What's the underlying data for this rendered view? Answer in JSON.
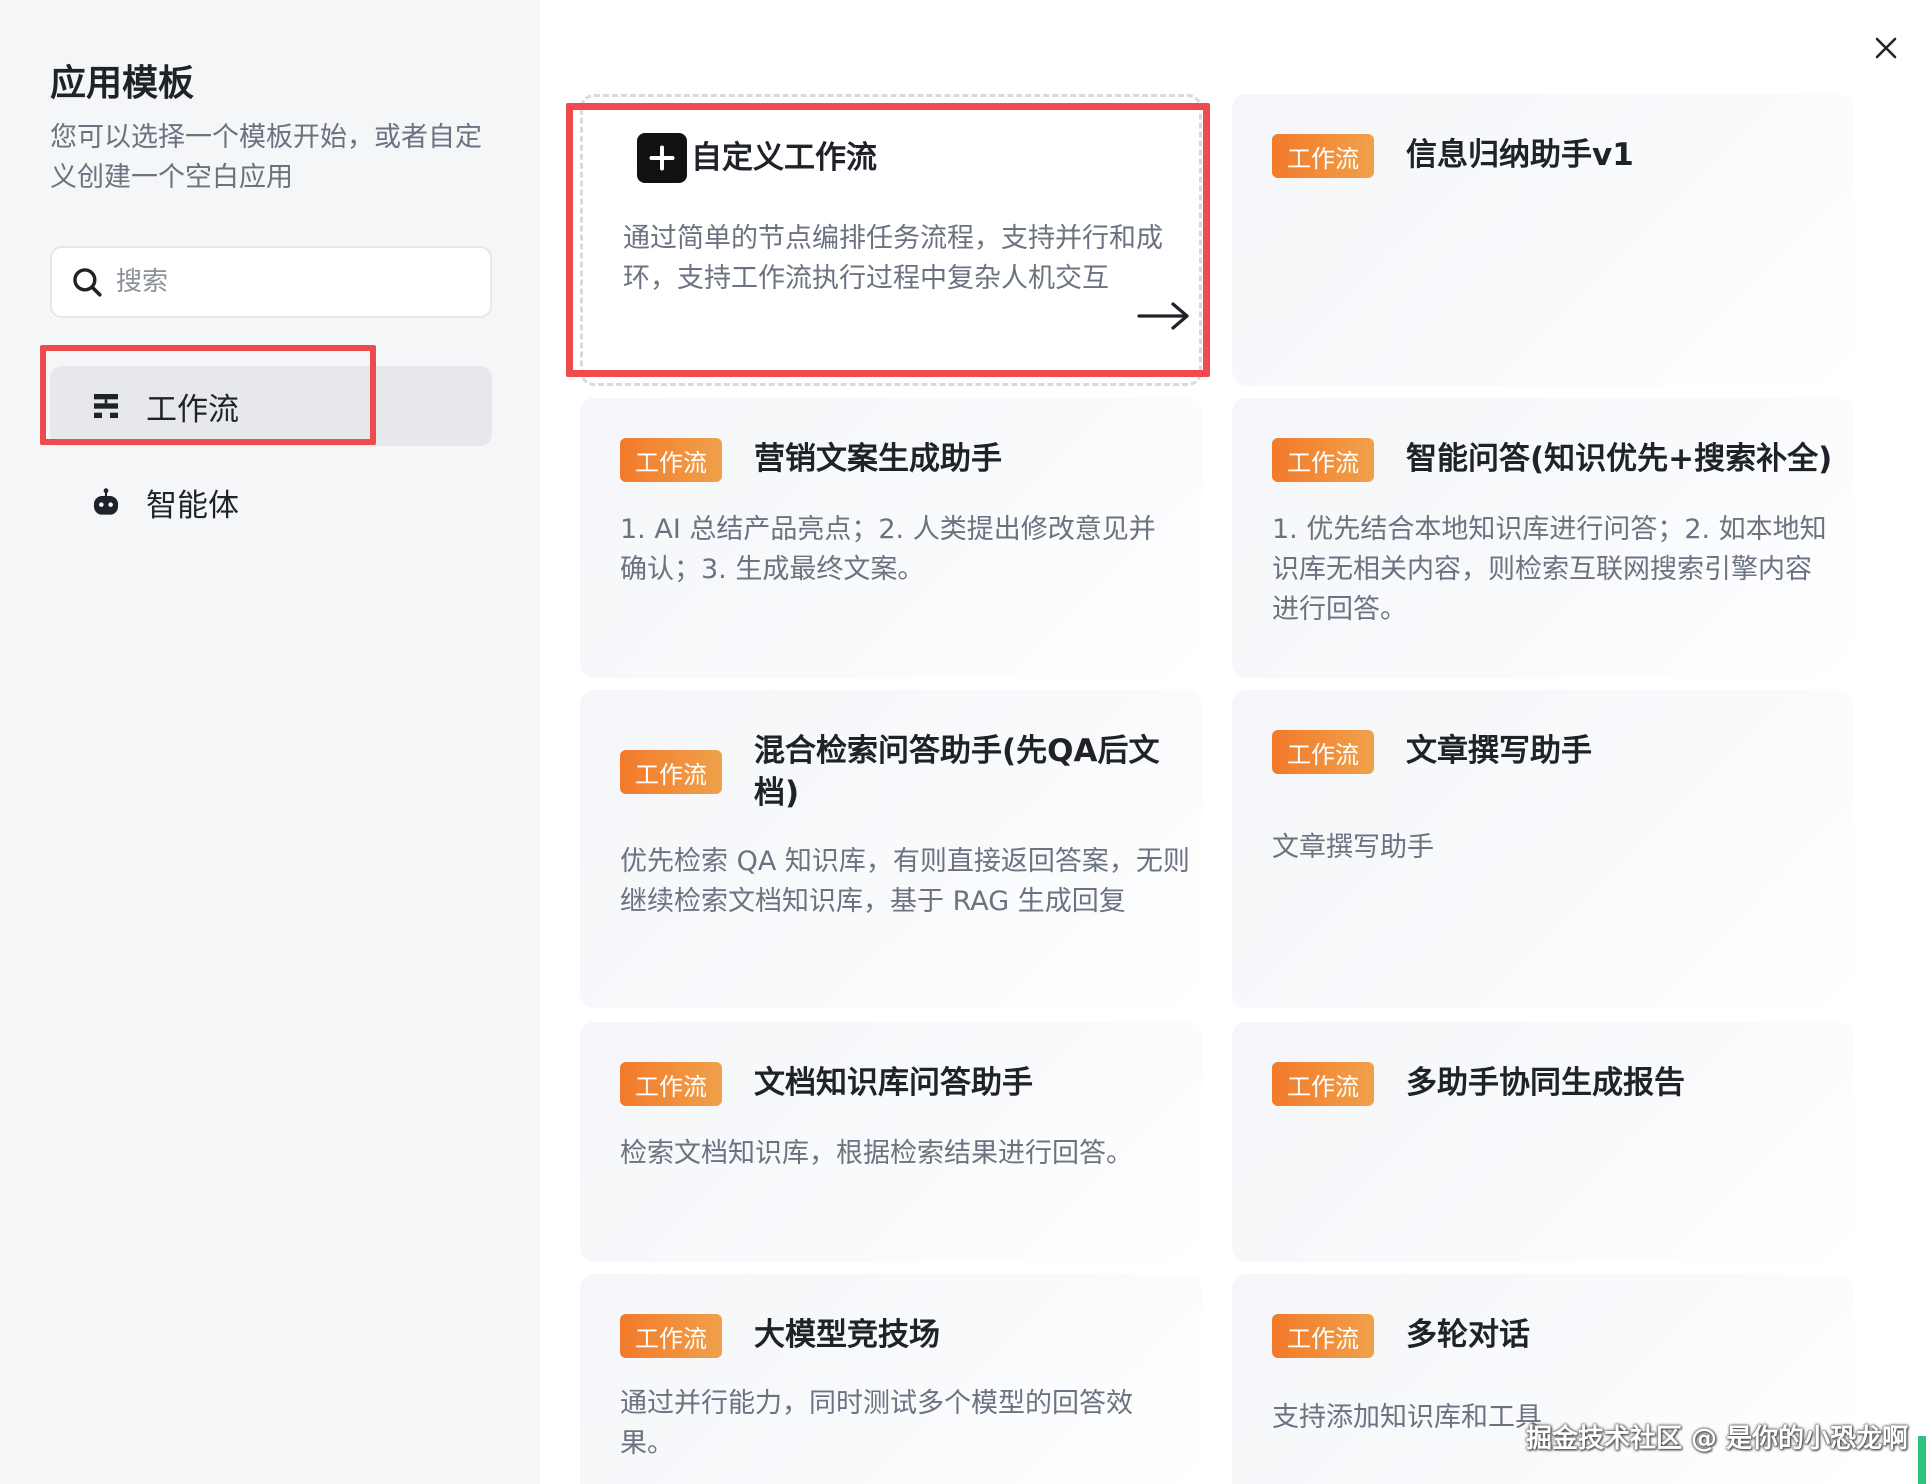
{
  "sidebar": {
    "title": "应用模板",
    "description": "您可以选择一个模板开始，或者自定义创建一个空白应用",
    "search_placeholder": "搜索",
    "nav": [
      {
        "label": "工作流",
        "icon": "workflow-icon",
        "active": true
      },
      {
        "label": "智能体",
        "icon": "robot-icon",
        "active": false
      }
    ]
  },
  "close_icon": "close-icon",
  "custom_card": {
    "icon": "plus-icon",
    "title": "自定义工作流",
    "description": "通过简单的节点编排任务流程，支持并行和成环，支持工作流执行过程中复杂人机交互",
    "arrow_icon": "arrow-right-icon"
  },
  "badge_label": "工作流",
  "templates": [
    {
      "title": "信息归纳助手v1",
      "description": ""
    },
    {
      "title": "营销文案生成助手",
      "description": "1. AI 总结产品亮点；2. 人类提出修改意见并确认；3. 生成最终文案。"
    },
    {
      "title": "智能问答(知识优先+搜索补全)",
      "description": "1. 优先结合本地知识库进行问答；2. 如本地知识库无相关内容，则检索互联网搜索引擎内容进行回答。"
    },
    {
      "title": "混合检索问答助手(先QA后文档)",
      "description": "优先检索 QA 知识库，有则直接返回答案，无则继续检索文档知识库，基于 RAG 生成回复"
    },
    {
      "title": "文章撰写助手",
      "description": "文章撰写助手"
    },
    {
      "title": "文档知识库问答助手",
      "description": "检索文档知识库，根据检索结果进行回答。"
    },
    {
      "title": "多助手协同生成报告",
      "description": ""
    },
    {
      "title": "大模型竞技场",
      "description": "通过并行能力，同时测试多个模型的回答效果。"
    },
    {
      "title": "多轮对话",
      "description": "支持添加知识库和工具"
    }
  ],
  "watermark": "掘金技术社区 @ 是你的小恐龙啊",
  "colors": {
    "badge_start": "#f27a2a",
    "badge_end": "#f0a14b",
    "highlight": "#ef4b4f",
    "sidebar_bg": "#f5f6f8"
  }
}
